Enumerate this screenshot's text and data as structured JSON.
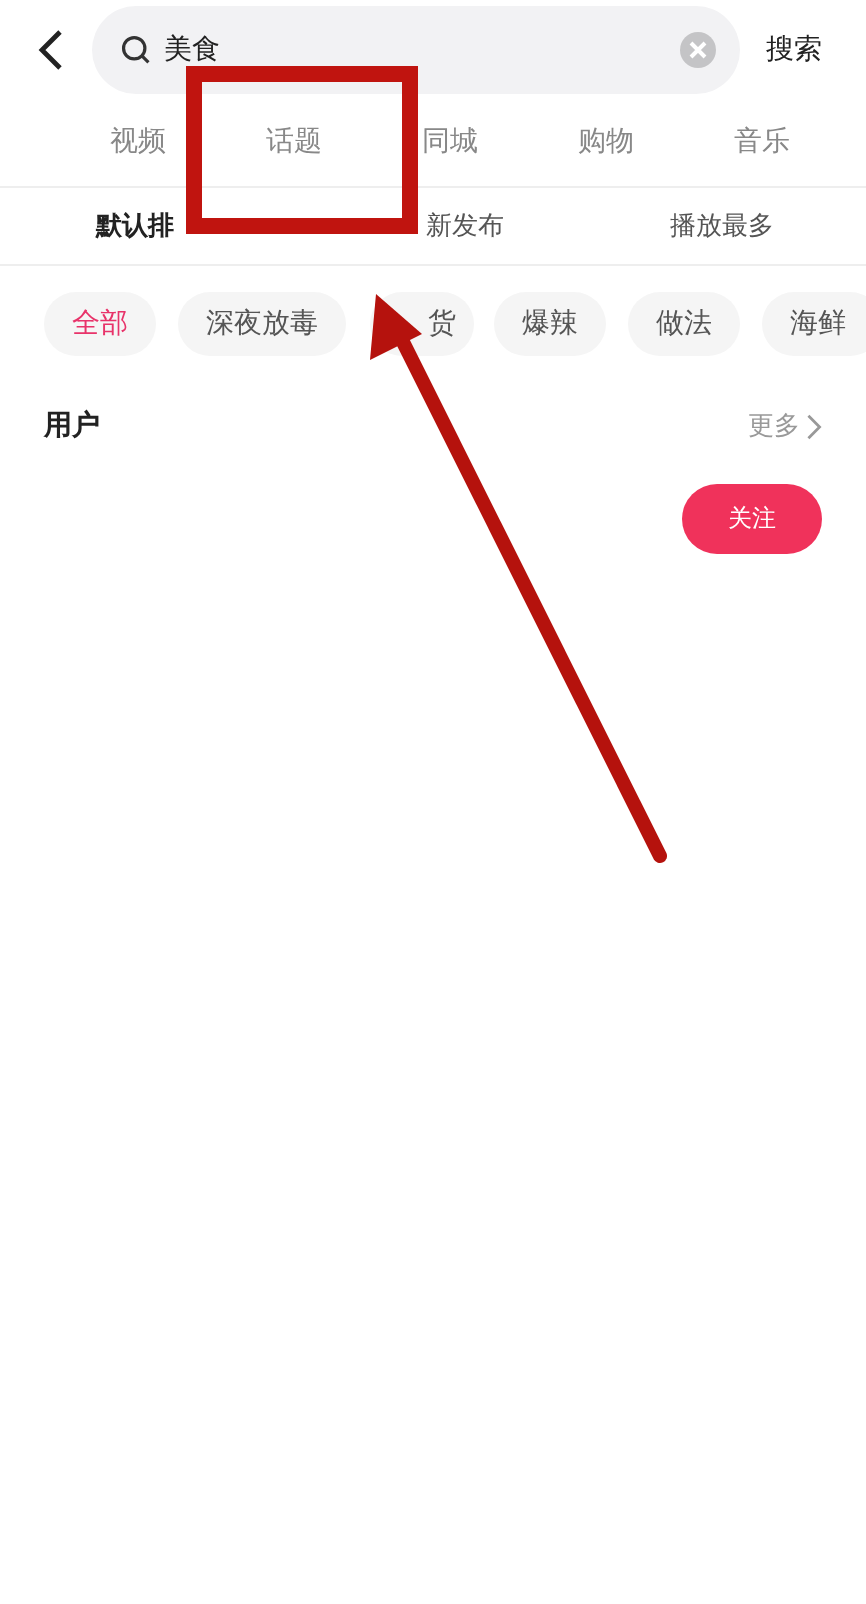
{
  "search": {
    "value": "美食",
    "button": "搜索"
  },
  "tabs": [
    {
      "label": "视频",
      "selected": false
    },
    {
      "label": "话题",
      "selected": false
    },
    {
      "label": "同城",
      "selected": false
    },
    {
      "label": "购物",
      "selected": false
    },
    {
      "label": "音乐",
      "selected": false
    }
  ],
  "sort_options": [
    {
      "label": "默认排",
      "selected": true
    },
    {
      "label": "新发布",
      "selected": false
    },
    {
      "label": "播放最多",
      "selected": false
    }
  ],
  "chips": [
    {
      "label": "全部",
      "selected": true
    },
    {
      "label": "深夜放毒",
      "selected": false
    },
    {
      "label": "货",
      "selected": false
    },
    {
      "label": "爆辣",
      "selected": false
    },
    {
      "label": "做法",
      "selected": false
    },
    {
      "label": "海鲜",
      "selected": false
    }
  ],
  "users_section": {
    "title": "用户",
    "more": "更多",
    "follow_button": "关注"
  }
}
